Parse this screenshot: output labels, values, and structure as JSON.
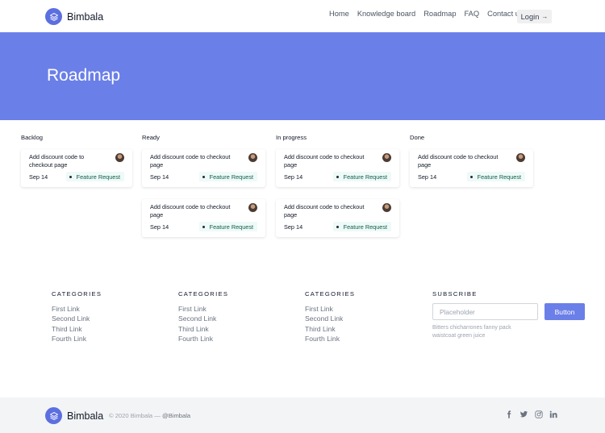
{
  "header": {
    "brand_name": "Bimbala",
    "nav": [
      "Home",
      "Knowledge board",
      "Roadmap",
      "FAQ",
      "Contact us"
    ],
    "login_label": "Login"
  },
  "hero": {
    "title": "Roadmap"
  },
  "board": {
    "columns": [
      {
        "title": "Backlog",
        "cards": [
          {
            "text": "Add discount code to checkout page",
            "date": "Sep 14",
            "tag": "Feature Request"
          }
        ]
      },
      {
        "title": "Ready",
        "cards": [
          {
            "text": "Add discount code to checkout page",
            "date": "Sep 14",
            "tag": "Feature Request"
          },
          {
            "text": "Add discount code to checkout page",
            "date": "Sep 14",
            "tag": "Feature Request"
          }
        ]
      },
      {
        "title": "In progress",
        "cards": [
          {
            "text": "Add discount code to checkout page",
            "date": "Sep 14",
            "tag": "Feature Request"
          },
          {
            "text": "Add discount code to checkout page",
            "date": "Sep 14",
            "tag": "Feature Request"
          }
        ]
      },
      {
        "title": "Done",
        "cards": [
          {
            "text": "Add discount code to checkout page",
            "date": "Sep 14",
            "tag": "Feature Request"
          }
        ]
      }
    ]
  },
  "footer": {
    "categories": [
      {
        "title": "CATEGORIES",
        "links": [
          "First Link",
          "Second Link",
          "Third Link",
          "Fourth Link"
        ]
      },
      {
        "title": "CATEGORIES",
        "links": [
          "First Link",
          "Second Link",
          "Third Link",
          "Fourth Link"
        ]
      },
      {
        "title": "CATEGORIES",
        "links": [
          "First Link",
          "Second Link",
          "Third Link",
          "Fourth Link"
        ]
      }
    ],
    "subscribe": {
      "title": "SUBSCRIBE",
      "placeholder": "Placeholder",
      "button_label": "Button",
      "note": "Bitters chicharrones fanny pack waistcoat green juice"
    },
    "bottom": {
      "brand_name": "Bimbala",
      "copyright": "© 2020 Bimbala —",
      "handle": "@Bimbala",
      "socials": [
        "facebook-icon",
        "twitter-icon",
        "instagram-icon",
        "linkedin-icon"
      ]
    }
  },
  "colors": {
    "accent": "#6b7fe8",
    "tag_bg": "#eefaf7"
  }
}
